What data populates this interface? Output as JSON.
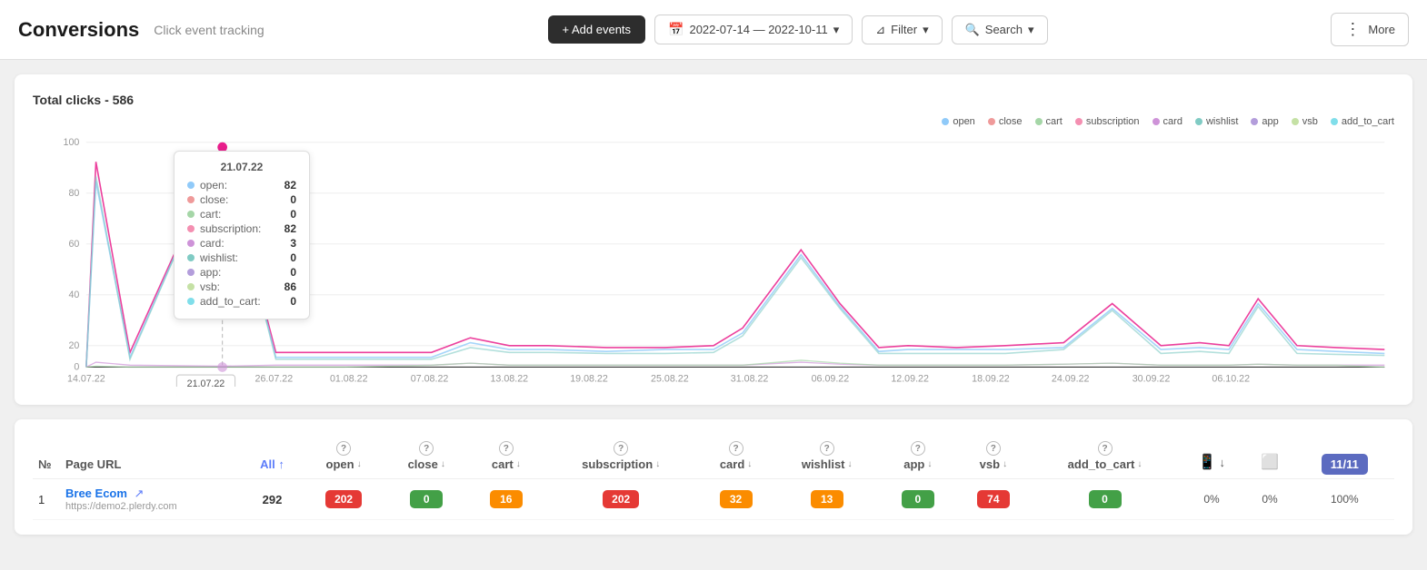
{
  "header": {
    "title": "Conversions",
    "subtitle": "Click event tracking",
    "add_button": "+ Add events",
    "date_range": "2022-07-14 — 2022-10-11",
    "filter_label": "Filter",
    "search_label": "Search",
    "more_label": "More"
  },
  "chart": {
    "title": "Total clicks - 586",
    "legend": [
      {
        "label": "open",
        "color": "#90caf9"
      },
      {
        "label": "close",
        "color": "#ef9a9a"
      },
      {
        "label": "cart",
        "color": "#a5d6a7"
      },
      {
        "label": "subscription",
        "color": "#f48fb1"
      },
      {
        "label": "card",
        "color": "#ce93d8"
      },
      {
        "label": "wishlist",
        "color": "#80cbc4"
      },
      {
        "label": "app",
        "color": "#b39ddb"
      },
      {
        "label": "vsb",
        "color": "#c5e1a5"
      },
      {
        "label": "add_to_cart",
        "color": "#80deea"
      }
    ],
    "tooltip": {
      "date": "21.07.22",
      "rows": [
        {
          "label": "open:",
          "value": "82",
          "color": "#90caf9"
        },
        {
          "label": "close:",
          "value": "0",
          "color": "#ef9a9a"
        },
        {
          "label": "cart:",
          "value": "0",
          "color": "#a5d6a7"
        },
        {
          "label": "subscription:",
          "value": "82",
          "color": "#f48fb1"
        },
        {
          "label": "card:",
          "value": "3",
          "color": "#ce93d8"
        },
        {
          "label": "wishlist:",
          "value": "0",
          "color": "#80cbc4"
        },
        {
          "label": "app:",
          "value": "0",
          "color": "#b39ddb"
        },
        {
          "label": "vsb:",
          "value": "86",
          "color": "#c5e1a5"
        },
        {
          "label": "add_to_cart:",
          "value": "0",
          "color": "#80deea"
        }
      ]
    },
    "x_labels": [
      "14.07.22",
      "21.07.22",
      "26.07.22",
      "01.08.22",
      "07.08.22",
      "13.08.22",
      "19.08.22",
      "25.08.22",
      "31.08.22",
      "06.09.22",
      "12.09.22",
      "18.09.22",
      "24.09.22",
      "30.09.22",
      "06.10.22"
    ],
    "y_labels": [
      "0",
      "20",
      "40",
      "60",
      "80",
      "100"
    ]
  },
  "table": {
    "columns": [
      {
        "key": "no",
        "label": "№"
      },
      {
        "key": "page_url",
        "label": "Page URL"
      },
      {
        "key": "all",
        "label": "All ↑"
      },
      {
        "key": "open",
        "label": "open ↓"
      },
      {
        "key": "close",
        "label": "close ↓"
      },
      {
        "key": "cart",
        "label": "cart ↓"
      },
      {
        "key": "subscription",
        "label": "subscription ↓"
      },
      {
        "key": "card",
        "label": "card ↓"
      },
      {
        "key": "wishlist",
        "label": "wishlist ↓"
      },
      {
        "key": "app",
        "label": "app ↓"
      },
      {
        "key": "vsb",
        "label": "vsb ↓"
      },
      {
        "key": "add_to_cart",
        "label": "add_to_cart ↓"
      },
      {
        "key": "mobile_pct",
        "label": ""
      },
      {
        "key": "tablet_pct",
        "label": ""
      },
      {
        "key": "desktop_pct",
        "label": ""
      }
    ],
    "rows": [
      {
        "no": "1",
        "page_url_name": "Bree Ecom",
        "page_url_href": "https://demo2.plerdy.com",
        "all": "292",
        "open": {
          "value": "202",
          "color": "red"
        },
        "close": {
          "value": "0",
          "color": "green"
        },
        "cart": {
          "value": "16",
          "color": "orange"
        },
        "subscription": {
          "value": "202",
          "color": "red"
        },
        "card": {
          "value": "32",
          "color": "orange"
        },
        "wishlist": {
          "value": "13",
          "color": "orange"
        },
        "app": {
          "value": "0",
          "color": "green"
        },
        "vsb": {
          "value": "74",
          "color": "red"
        },
        "add_to_cart": {
          "value": "0",
          "color": "green"
        },
        "mobile_pct": "0%",
        "tablet_pct": "0%",
        "desktop_pct": "100%"
      }
    ],
    "pagination": "11/11"
  }
}
